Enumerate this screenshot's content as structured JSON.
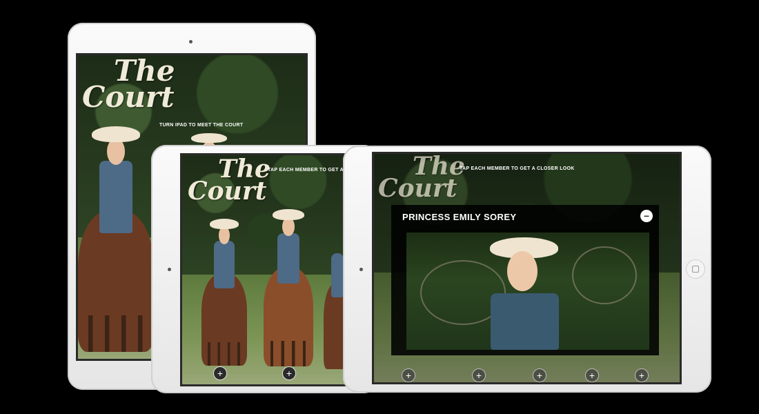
{
  "app": {
    "logo_line1": "The",
    "logo_line2": "Court"
  },
  "portrait_ipad": {
    "instruction": "TURN IPAD TO MEET THE COURT"
  },
  "landscape_ipad_left": {
    "instruction": "TAP EACH MEMBER TO GET A C",
    "plus_buttons": [
      "+",
      "+"
    ]
  },
  "landscape_ipad_right": {
    "instruction": "TAP EACH MEMBER TO GET A CLOSER LOOK",
    "overlay": {
      "title": "PRINCESS EMILY SOREY",
      "close_symbol": "–"
    },
    "plus_buttons": [
      "+",
      "+",
      "+",
      "+",
      "+"
    ]
  },
  "icons": [
    "camera-icon",
    "home-button-icon",
    "plus-icon",
    "minus-icon"
  ],
  "colors": {
    "background": "#000000",
    "device_body": "#f2f2f2",
    "logo_text": "#f0ead8"
  }
}
